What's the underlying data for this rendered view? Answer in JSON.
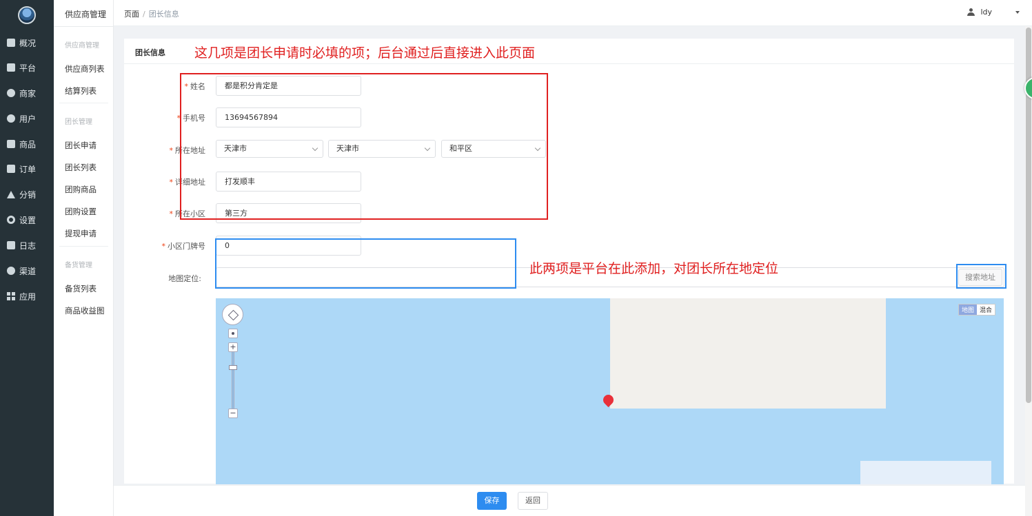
{
  "sidebar": {
    "items": [
      {
        "label": "概况",
        "icon": "monitor-icon"
      },
      {
        "label": "平台",
        "icon": "desktop-icon"
      },
      {
        "label": "商家",
        "icon": "store-icon"
      },
      {
        "label": "用户",
        "icon": "user-icon"
      },
      {
        "label": "商品",
        "icon": "product-icon"
      },
      {
        "label": "订单",
        "icon": "order-icon"
      },
      {
        "label": "分销",
        "icon": "sitemap-icon"
      },
      {
        "label": "设置",
        "icon": "gear-icon"
      },
      {
        "label": "日志",
        "icon": "book-icon"
      },
      {
        "label": "渠道",
        "icon": "channel-icon"
      },
      {
        "label": "应用",
        "icon": "apps-grid-icon"
      }
    ]
  },
  "subnav": {
    "title": "供应商管理",
    "groups": [
      {
        "title": "供应商管理",
        "items": [
          "供应商列表",
          "结算列表"
        ]
      },
      {
        "title": "团长管理",
        "items": [
          "团长申请",
          "团长列表",
          "团购商品",
          "团购设置",
          "提现申请"
        ]
      },
      {
        "title": "备货管理",
        "items": [
          "备货列表",
          "商品收益图"
        ]
      }
    ]
  },
  "header": {
    "breadcrumb": [
      "页面",
      "团长信息"
    ],
    "user": "ldy"
  },
  "card": {
    "title": "团长信息"
  },
  "form": {
    "name": {
      "label": "姓名",
      "value": "都是积分肯定是"
    },
    "phone": {
      "label": "手机号",
      "value": "13694567894"
    },
    "region": {
      "label": "所在地址",
      "province": "天津市",
      "city": "天津市",
      "district": "和平区"
    },
    "address": {
      "label": "详细地址",
      "value": "打发顺丰"
    },
    "community": {
      "label": "所在小区",
      "value": "第三方"
    },
    "door": {
      "label": "小区门牌号",
      "value": "0"
    },
    "map": {
      "label": "地图定位:",
      "value": "",
      "search_button": "搜索地址"
    }
  },
  "map": {
    "type_map": "地图",
    "type_hybrid": "混合"
  },
  "actions": {
    "save": "保存",
    "back": "返回"
  },
  "annotations": {
    "required_note": "这几项是团长申请时必填的项；后台通过后直接进入此页面",
    "platform_note": "此两项是平台在此添加，对团长所在地定位"
  },
  "colors": {
    "sidebar_bg": "#263238",
    "primary": "#2d8cf0",
    "required": "#ed4014",
    "annotation_red": "#e02020",
    "annotation_blue": "#2d8cf0",
    "map_water": "#add8f7"
  }
}
